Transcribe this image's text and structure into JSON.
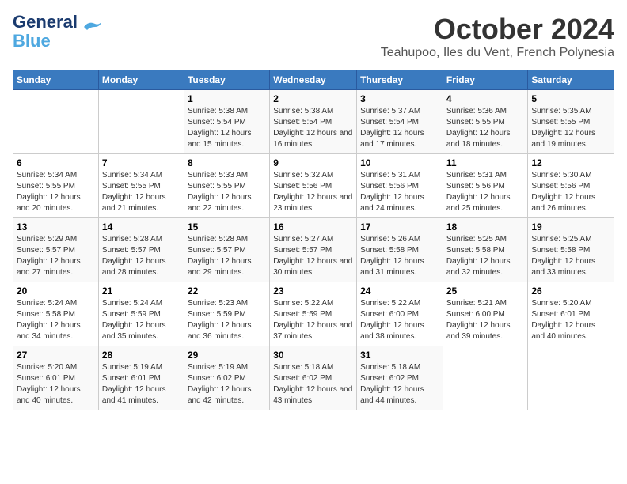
{
  "header": {
    "logo_line1": "General",
    "logo_line2": "Blue",
    "month_year": "October 2024",
    "location": "Teahupoo, Iles du Vent, French Polynesia"
  },
  "weekdays": [
    "Sunday",
    "Monday",
    "Tuesday",
    "Wednesday",
    "Thursday",
    "Friday",
    "Saturday"
  ],
  "weeks": [
    [
      {
        "day": "",
        "sunrise": "",
        "sunset": "",
        "daylight": ""
      },
      {
        "day": "",
        "sunrise": "",
        "sunset": "",
        "daylight": ""
      },
      {
        "day": "1",
        "sunrise": "Sunrise: 5:38 AM",
        "sunset": "Sunset: 5:54 PM",
        "daylight": "Daylight: 12 hours and 15 minutes."
      },
      {
        "day": "2",
        "sunrise": "Sunrise: 5:38 AM",
        "sunset": "Sunset: 5:54 PM",
        "daylight": "Daylight: 12 hours and 16 minutes."
      },
      {
        "day": "3",
        "sunrise": "Sunrise: 5:37 AM",
        "sunset": "Sunset: 5:54 PM",
        "daylight": "Daylight: 12 hours and 17 minutes."
      },
      {
        "day": "4",
        "sunrise": "Sunrise: 5:36 AM",
        "sunset": "Sunset: 5:55 PM",
        "daylight": "Daylight: 12 hours and 18 minutes."
      },
      {
        "day": "5",
        "sunrise": "Sunrise: 5:35 AM",
        "sunset": "Sunset: 5:55 PM",
        "daylight": "Daylight: 12 hours and 19 minutes."
      }
    ],
    [
      {
        "day": "6",
        "sunrise": "Sunrise: 5:34 AM",
        "sunset": "Sunset: 5:55 PM",
        "daylight": "Daylight: 12 hours and 20 minutes."
      },
      {
        "day": "7",
        "sunrise": "Sunrise: 5:34 AM",
        "sunset": "Sunset: 5:55 PM",
        "daylight": "Daylight: 12 hours and 21 minutes."
      },
      {
        "day": "8",
        "sunrise": "Sunrise: 5:33 AM",
        "sunset": "Sunset: 5:55 PM",
        "daylight": "Daylight: 12 hours and 22 minutes."
      },
      {
        "day": "9",
        "sunrise": "Sunrise: 5:32 AM",
        "sunset": "Sunset: 5:56 PM",
        "daylight": "Daylight: 12 hours and 23 minutes."
      },
      {
        "day": "10",
        "sunrise": "Sunrise: 5:31 AM",
        "sunset": "Sunset: 5:56 PM",
        "daylight": "Daylight: 12 hours and 24 minutes."
      },
      {
        "day": "11",
        "sunrise": "Sunrise: 5:31 AM",
        "sunset": "Sunset: 5:56 PM",
        "daylight": "Daylight: 12 hours and 25 minutes."
      },
      {
        "day": "12",
        "sunrise": "Sunrise: 5:30 AM",
        "sunset": "Sunset: 5:56 PM",
        "daylight": "Daylight: 12 hours and 26 minutes."
      }
    ],
    [
      {
        "day": "13",
        "sunrise": "Sunrise: 5:29 AM",
        "sunset": "Sunset: 5:57 PM",
        "daylight": "Daylight: 12 hours and 27 minutes."
      },
      {
        "day": "14",
        "sunrise": "Sunrise: 5:28 AM",
        "sunset": "Sunset: 5:57 PM",
        "daylight": "Daylight: 12 hours and 28 minutes."
      },
      {
        "day": "15",
        "sunrise": "Sunrise: 5:28 AM",
        "sunset": "Sunset: 5:57 PM",
        "daylight": "Daylight: 12 hours and 29 minutes."
      },
      {
        "day": "16",
        "sunrise": "Sunrise: 5:27 AM",
        "sunset": "Sunset: 5:57 PM",
        "daylight": "Daylight: 12 hours and 30 minutes."
      },
      {
        "day": "17",
        "sunrise": "Sunrise: 5:26 AM",
        "sunset": "Sunset: 5:58 PM",
        "daylight": "Daylight: 12 hours and 31 minutes."
      },
      {
        "day": "18",
        "sunrise": "Sunrise: 5:25 AM",
        "sunset": "Sunset: 5:58 PM",
        "daylight": "Daylight: 12 hours and 32 minutes."
      },
      {
        "day": "19",
        "sunrise": "Sunrise: 5:25 AM",
        "sunset": "Sunset: 5:58 PM",
        "daylight": "Daylight: 12 hours and 33 minutes."
      }
    ],
    [
      {
        "day": "20",
        "sunrise": "Sunrise: 5:24 AM",
        "sunset": "Sunset: 5:58 PM",
        "daylight": "Daylight: 12 hours and 34 minutes."
      },
      {
        "day": "21",
        "sunrise": "Sunrise: 5:24 AM",
        "sunset": "Sunset: 5:59 PM",
        "daylight": "Daylight: 12 hours and 35 minutes."
      },
      {
        "day": "22",
        "sunrise": "Sunrise: 5:23 AM",
        "sunset": "Sunset: 5:59 PM",
        "daylight": "Daylight: 12 hours and 36 minutes."
      },
      {
        "day": "23",
        "sunrise": "Sunrise: 5:22 AM",
        "sunset": "Sunset: 5:59 PM",
        "daylight": "Daylight: 12 hours and 37 minutes."
      },
      {
        "day": "24",
        "sunrise": "Sunrise: 5:22 AM",
        "sunset": "Sunset: 6:00 PM",
        "daylight": "Daylight: 12 hours and 38 minutes."
      },
      {
        "day": "25",
        "sunrise": "Sunrise: 5:21 AM",
        "sunset": "Sunset: 6:00 PM",
        "daylight": "Daylight: 12 hours and 39 minutes."
      },
      {
        "day": "26",
        "sunrise": "Sunrise: 5:20 AM",
        "sunset": "Sunset: 6:01 PM",
        "daylight": "Daylight: 12 hours and 40 minutes."
      }
    ],
    [
      {
        "day": "27",
        "sunrise": "Sunrise: 5:20 AM",
        "sunset": "Sunset: 6:01 PM",
        "daylight": "Daylight: 12 hours and 40 minutes."
      },
      {
        "day": "28",
        "sunrise": "Sunrise: 5:19 AM",
        "sunset": "Sunset: 6:01 PM",
        "daylight": "Daylight: 12 hours and 41 minutes."
      },
      {
        "day": "29",
        "sunrise": "Sunrise: 5:19 AM",
        "sunset": "Sunset: 6:02 PM",
        "daylight": "Daylight: 12 hours and 42 minutes."
      },
      {
        "day": "30",
        "sunrise": "Sunrise: 5:18 AM",
        "sunset": "Sunset: 6:02 PM",
        "daylight": "Daylight: 12 hours and 43 minutes."
      },
      {
        "day": "31",
        "sunrise": "Sunrise: 5:18 AM",
        "sunset": "Sunset: 6:02 PM",
        "daylight": "Daylight: 12 hours and 44 minutes."
      },
      {
        "day": "",
        "sunrise": "",
        "sunset": "",
        "daylight": ""
      },
      {
        "day": "",
        "sunrise": "",
        "sunset": "",
        "daylight": ""
      }
    ]
  ]
}
